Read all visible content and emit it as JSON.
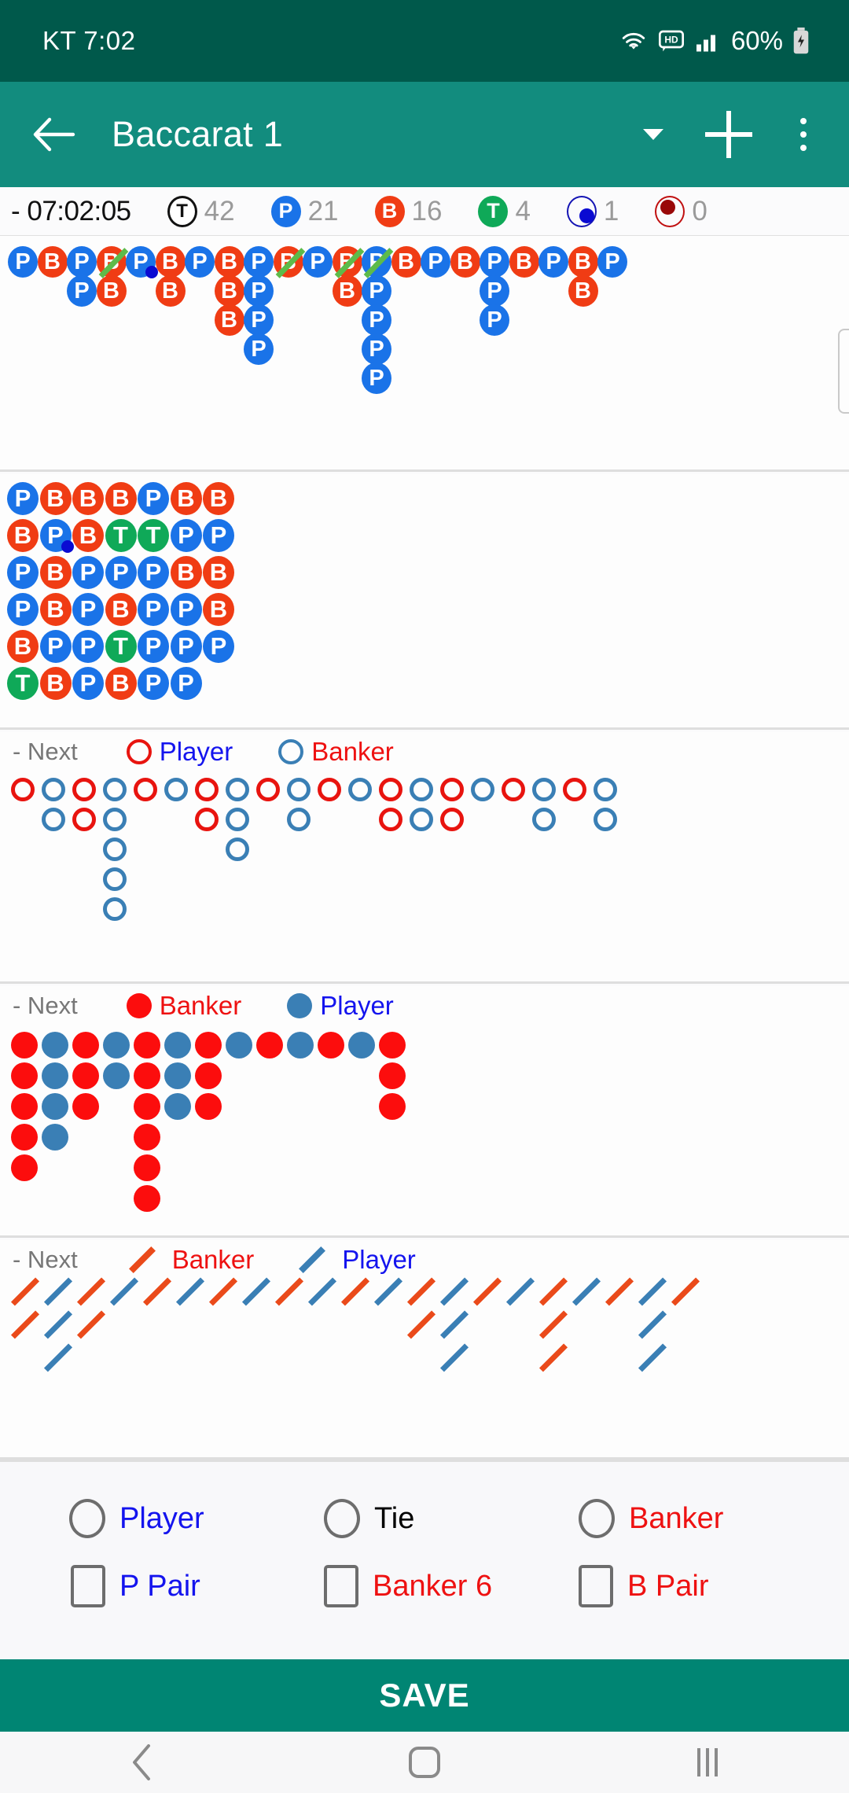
{
  "statusbar": {
    "carrier_time": "KT 7:02",
    "battery": "60%",
    "icons": [
      "wifi-icon",
      "hd-icon",
      "signal-icon",
      "battery-icon"
    ]
  },
  "appbar": {
    "title": "Baccarat 1",
    "back": "back-arrow",
    "dropdown": "caret",
    "add": "plus",
    "overflow": "kebab"
  },
  "stats": {
    "clock": "- 07:02:05",
    "items": [
      {
        "badge": "T",
        "kind": "total",
        "count": "42"
      },
      {
        "badge": "P",
        "kind": "player",
        "count": "21"
      },
      {
        "badge": "B",
        "kind": "banker",
        "count": "16"
      },
      {
        "badge": "T",
        "kind": "tie",
        "count": "4"
      },
      {
        "badge": "",
        "kind": "player-pair",
        "count": "1"
      },
      {
        "badge": "",
        "kind": "banker-pair",
        "count": "0"
      }
    ]
  },
  "big_road": {
    "name": "big-road",
    "columns": [
      {
        "cells": [
          {
            "v": "P"
          }
        ]
      },
      {
        "cells": [
          {
            "v": "B"
          }
        ]
      },
      {
        "cells": [
          {
            "v": "P"
          },
          {
            "v": "P"
          }
        ]
      },
      {
        "cells": [
          {
            "v": "B",
            "slash": true
          },
          {
            "v": "B"
          }
        ]
      },
      {
        "cells": [
          {
            "v": "P",
            "pdot": true
          }
        ]
      },
      {
        "cells": [
          {
            "v": "B"
          },
          {
            "v": "B"
          }
        ]
      },
      {
        "cells": [
          {
            "v": "P"
          }
        ]
      },
      {
        "cells": [
          {
            "v": "B"
          },
          {
            "v": "B"
          },
          {
            "v": "B"
          }
        ]
      },
      {
        "cells": [
          {
            "v": "P"
          },
          {
            "v": "P"
          },
          {
            "v": "P"
          },
          {
            "v": "P"
          }
        ]
      },
      {
        "cells": [
          {
            "v": "B",
            "slash": true
          }
        ]
      },
      {
        "cells": [
          {
            "v": "P"
          }
        ]
      },
      {
        "cells": [
          {
            "v": "B",
            "slash": true
          },
          {
            "v": "B"
          }
        ]
      },
      {
        "cells": [
          {
            "v": "P",
            "slash": true
          },
          {
            "v": "P"
          },
          {
            "v": "P"
          },
          {
            "v": "P"
          },
          {
            "v": "P"
          }
        ]
      },
      {
        "cells": [
          {
            "v": "B"
          }
        ]
      },
      {
        "cells": [
          {
            "v": "P"
          }
        ]
      },
      {
        "cells": [
          {
            "v": "B"
          }
        ]
      },
      {
        "cells": [
          {
            "v": "P"
          },
          {
            "v": "P"
          },
          {
            "v": "P"
          }
        ]
      },
      {
        "cells": [
          {
            "v": "B"
          }
        ]
      },
      {
        "cells": [
          {
            "v": "P"
          }
        ]
      },
      {
        "cells": [
          {
            "v": "B"
          },
          {
            "v": "B"
          }
        ]
      },
      {
        "cells": [
          {
            "v": "P"
          }
        ]
      }
    ]
  },
  "bead_plate": {
    "name": "bead-plate",
    "rows": [
      [
        {
          "v": "P"
        },
        {
          "v": "B"
        },
        {
          "v": "B"
        },
        {
          "v": "B"
        },
        {
          "v": "P"
        },
        {
          "v": "B"
        },
        {
          "v": "B"
        }
      ],
      [
        {
          "v": "B"
        },
        {
          "v": "P",
          "pdot": true
        },
        {
          "v": "B"
        },
        {
          "v": "T"
        },
        {
          "v": "T"
        },
        {
          "v": "P"
        },
        {
          "v": "P"
        }
      ],
      [
        {
          "v": "P"
        },
        {
          "v": "B"
        },
        {
          "v": "P"
        },
        {
          "v": "P"
        },
        {
          "v": "P"
        },
        {
          "v": "B"
        },
        {
          "v": "B"
        }
      ],
      [
        {
          "v": "P"
        },
        {
          "v": "B"
        },
        {
          "v": "P"
        },
        {
          "v": "B"
        },
        {
          "v": "P"
        },
        {
          "v": "P"
        },
        {
          "v": "B"
        }
      ],
      [
        {
          "v": "B"
        },
        {
          "v": "P"
        },
        {
          "v": "P"
        },
        {
          "v": "T"
        },
        {
          "v": "P"
        },
        {
          "v": "P"
        },
        {
          "v": "P"
        }
      ],
      [
        {
          "v": "T"
        },
        {
          "v": "B"
        },
        {
          "v": "P"
        },
        {
          "v": "B"
        },
        {
          "v": "P"
        },
        {
          "v": "P"
        }
      ]
    ]
  },
  "big_eye_road": {
    "name": "big-eye-boy-road",
    "legend": {
      "next": "- Next",
      "first_label": "Player",
      "first_color": "#e8140f",
      "second_label": "Banker",
      "second_color": "#3a7fb5"
    },
    "columns": [
      {
        "cells": [
          "P"
        ]
      },
      {
        "cells": [
          "B",
          "B"
        ]
      },
      {
        "cells": [
          "P",
          "P"
        ]
      },
      {
        "cells": [
          "B",
          "B",
          "B",
          "B",
          "B"
        ]
      },
      {
        "cells": [
          "P"
        ]
      },
      {
        "cells": [
          "B"
        ]
      },
      {
        "cells": [
          "P",
          "P"
        ]
      },
      {
        "cells": [
          "B",
          "B",
          "B"
        ]
      },
      {
        "cells": [
          "P"
        ]
      },
      {
        "cells": [
          "B",
          "B"
        ]
      },
      {
        "cells": [
          "P"
        ]
      },
      {
        "cells": [
          "B"
        ]
      },
      {
        "cells": [
          "P",
          "P"
        ]
      },
      {
        "cells": [
          "B",
          "B"
        ]
      },
      {
        "cells": [
          "P",
          "P"
        ]
      },
      {
        "cells": [
          "B"
        ]
      },
      {
        "cells": [
          "P"
        ]
      },
      {
        "cells": [
          "B",
          "B"
        ]
      },
      {
        "cells": [
          "P"
        ]
      },
      {
        "cells": [
          "B",
          "B"
        ]
      }
    ]
  },
  "small_road": {
    "name": "small-road",
    "legend": {
      "next": "- Next",
      "first_label": "Banker",
      "first_color": "#fc0d0d",
      "second_label": "Player",
      "second_color": "#3a7fb5"
    },
    "columns": [
      {
        "cells": [
          "P",
          "P",
          "P",
          "P",
          "P"
        ]
      },
      {
        "cells": [
          "B",
          "B",
          "B",
          "B"
        ]
      },
      {
        "cells": [
          "P",
          "P",
          "P"
        ]
      },
      {
        "cells": [
          "B",
          "B"
        ]
      },
      {
        "cells": [
          "P",
          "P",
          "P",
          "P",
          "P",
          "P"
        ]
      },
      {
        "cells": [
          "B",
          "B",
          "B"
        ]
      },
      {
        "cells": [
          "P",
          "P",
          "P"
        ]
      },
      {
        "cells": [
          "B"
        ]
      },
      {
        "cells": [
          "P"
        ]
      },
      {
        "cells": [
          "B"
        ]
      },
      {
        "cells": [
          "P"
        ]
      },
      {
        "cells": [
          "B"
        ]
      },
      {
        "cells": [
          "P",
          "P",
          "P"
        ]
      }
    ]
  },
  "cockroach_road": {
    "name": "cockroach-pig-road",
    "legend": {
      "next": "- Next",
      "first_label": "Banker",
      "first_color": "#ea4a1a",
      "second_label": "Player",
      "second_color": "#3a7fb5"
    },
    "columns": [
      {
        "cells": [
          "P",
          "P"
        ]
      },
      {
        "cells": [
          "B",
          "B",
          "B"
        ]
      },
      {
        "cells": [
          "P",
          "P"
        ]
      },
      {
        "cells": [
          "B"
        ]
      },
      {
        "cells": [
          "P"
        ]
      },
      {
        "cells": [
          "B"
        ]
      },
      {
        "cells": [
          "P"
        ]
      },
      {
        "cells": [
          "B"
        ]
      },
      {
        "cells": [
          "P"
        ]
      },
      {
        "cells": [
          "B"
        ]
      },
      {
        "cells": [
          "P"
        ]
      },
      {
        "cells": [
          "B"
        ]
      },
      {
        "cells": [
          "P",
          "P"
        ]
      },
      {
        "cells": [
          "B",
          "B",
          "B"
        ]
      },
      {
        "cells": [
          "P"
        ]
      },
      {
        "cells": [
          "B"
        ]
      },
      {
        "cells": [
          "P",
          "P",
          "P"
        ]
      },
      {
        "cells": [
          "B"
        ]
      },
      {
        "cells": [
          "P"
        ]
      },
      {
        "cells": [
          "B",
          "B",
          "B"
        ]
      },
      {
        "cells": [
          "P"
        ]
      }
    ]
  },
  "controls": {
    "row1": [
      {
        "type": "radio",
        "label": "Player",
        "color": "#1414ee",
        "checked": false
      },
      {
        "type": "radio",
        "label": "Tie",
        "color": "#111111",
        "checked": false
      },
      {
        "type": "radio",
        "label": "Banker",
        "color": "#ee1111",
        "checked": false
      }
    ],
    "row2": [
      {
        "type": "checkbox",
        "label": "P Pair",
        "color": "#1414ee",
        "checked": false
      },
      {
        "type": "checkbox",
        "label": "Banker 6",
        "color": "#ee1111",
        "checked": false
      },
      {
        "type": "checkbox",
        "label": "B Pair",
        "color": "#ee1111",
        "checked": false
      }
    ]
  },
  "save_button": {
    "label": "SAVE"
  },
  "navbar": {
    "back": "nav-back-icon",
    "home": "nav-home-icon",
    "recents": "nav-recents-icon"
  },
  "colors": {
    "accent": "#128c7e",
    "statusbar": "#00594b",
    "player": "#1a73e8",
    "banker": "#f03c14",
    "tie": "#0fa958",
    "save": "#008573"
  }
}
